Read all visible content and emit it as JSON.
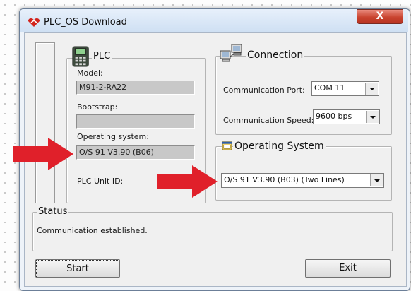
{
  "window": {
    "title": "PLC_OS Download",
    "close_label": "X"
  },
  "plc": {
    "legend": "PLC",
    "model_label": "Model:",
    "model_value": "M91-2-RA22",
    "bootstrap_label": "Bootstrap:",
    "bootstrap_value": "",
    "os_label": "Operating system:",
    "os_value": "O/S 91 V3.90 (B06)",
    "unit_id_label": "PLC Unit ID:"
  },
  "connection": {
    "legend": "Connection",
    "port_label": "Communication Port:",
    "port_value": "COM 11",
    "speed_label": "Communication Speed:",
    "speed_value": "9600  bps"
  },
  "operating_system": {
    "legend": "Operating System",
    "selected": "O/S 91 V3.90 (B03) (Two Lines)"
  },
  "status": {
    "legend": "Status",
    "message": "Communication established."
  },
  "buttons": {
    "start": "Start",
    "exit": "Exit"
  },
  "colors": {
    "annotation_arrow": "#e0202a",
    "close_button": "#c9432f"
  },
  "icons": {
    "title": "unitronics-logo-icon",
    "plc": "plc-device-icon",
    "connection": "network-computers-icon",
    "operating_system": "os-window-icon"
  }
}
